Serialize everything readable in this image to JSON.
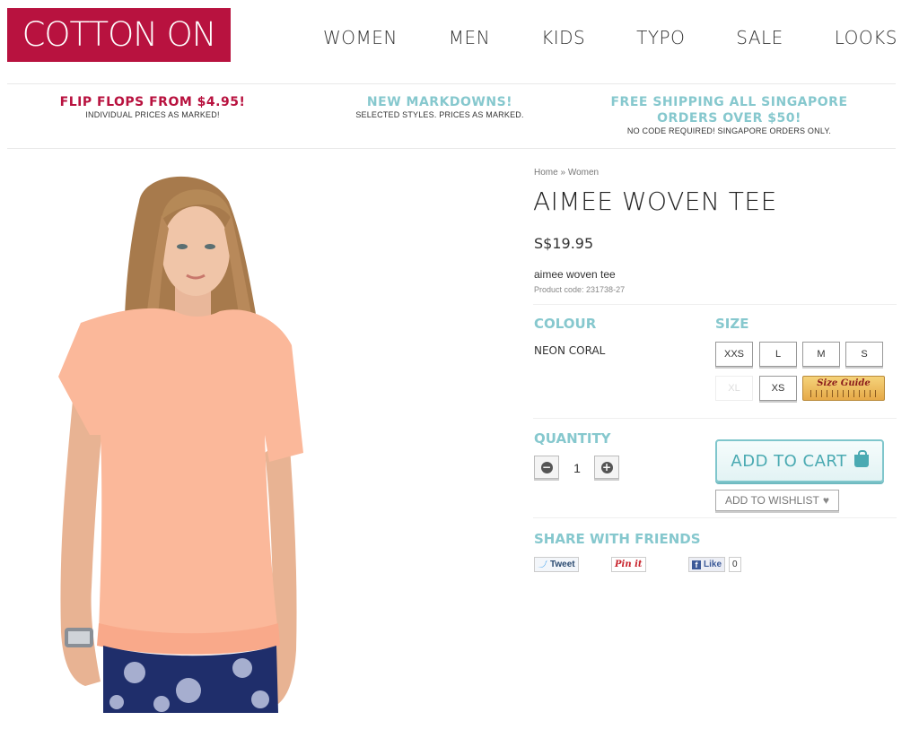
{
  "header": {
    "logo": "COTTON ON",
    "nav": [
      "WOMEN",
      "MEN",
      "KIDS",
      "TYPO",
      "SALE",
      "LOOKS"
    ]
  },
  "promos": [
    {
      "title": "FLIP FLOPS FROM $4.95!",
      "sub": "INDIVIDUAL PRICES AS MARKED!",
      "color": "#b8123f"
    },
    {
      "title": "NEW MARKDOWNS!",
      "sub": "SELECTED STYLES. PRICES AS MARKED.",
      "color": "#86c8ce"
    },
    {
      "title1": "FREE SHIPPING ALL SINGAPORE",
      "title2": "ORDERS OVER $50!",
      "sub": "NO CODE REQUIRED! SINGAPORE ORDERS ONLY.",
      "color": "#86c8ce"
    }
  ],
  "breadcrumb": {
    "home": "Home",
    "sep": "»",
    "current": "Women"
  },
  "product": {
    "title": "AIMEE WOVEN TEE",
    "price": "S$19.95",
    "description": "aimee woven tee",
    "code": "Product code: 231738-27"
  },
  "colour": {
    "label": "COLOUR",
    "value": "NEON CORAL"
  },
  "size": {
    "label": "SIZE",
    "options": [
      "XXS",
      "L",
      "M",
      "S",
      "XL",
      "XS"
    ],
    "guide": "Size Guide"
  },
  "quantity": {
    "label": "QUANTITY",
    "value": "1",
    "minus": "−",
    "plus": "+"
  },
  "cart": {
    "add_label": "ADD TO CART",
    "wishlist_label": "ADD TO WISHLIST",
    "heart": "♥"
  },
  "share": {
    "label": "SHARE WITH FRIENDS",
    "tweet": "Tweet",
    "pin": "Pin it",
    "like": "Like",
    "like_count": "0"
  },
  "colors": {
    "brand": "#b8123f",
    "accent": "#86c8ce"
  }
}
